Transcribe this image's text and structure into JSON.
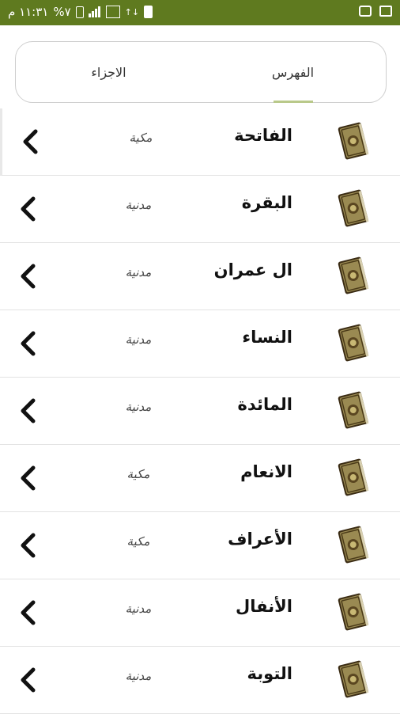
{
  "status_bar": {
    "time": "١١:٣١ م",
    "battery": "%٧",
    "icons": [
      "battery-icon",
      "signal-icon",
      "sim-icon",
      "data-icon",
      "notification-icon",
      "wifi-icon",
      "image-icon"
    ]
  },
  "tabs": {
    "fihris": "الفهرس",
    "ajza": "الاجزاء",
    "active": "fihris"
  },
  "colors": {
    "status_bar": "#5f7a1f",
    "tab_indicator": "#b9c98a",
    "book_cover": "#8a7a45"
  },
  "surahs": [
    {
      "name": "الفاتحة",
      "type": "مكية"
    },
    {
      "name": "البقرة",
      "type": "مدنية"
    },
    {
      "name": "ال عمران",
      "type": "مدنية"
    },
    {
      "name": "النساء",
      "type": "مدنية"
    },
    {
      "name": "المائدة",
      "type": "مدنية"
    },
    {
      "name": "الانعام",
      "type": "مكية"
    },
    {
      "name": "الأعراف",
      "type": "مكية"
    },
    {
      "name": "الأنفال",
      "type": "مدنية"
    },
    {
      "name": "التوبة",
      "type": "مدنية"
    }
  ]
}
